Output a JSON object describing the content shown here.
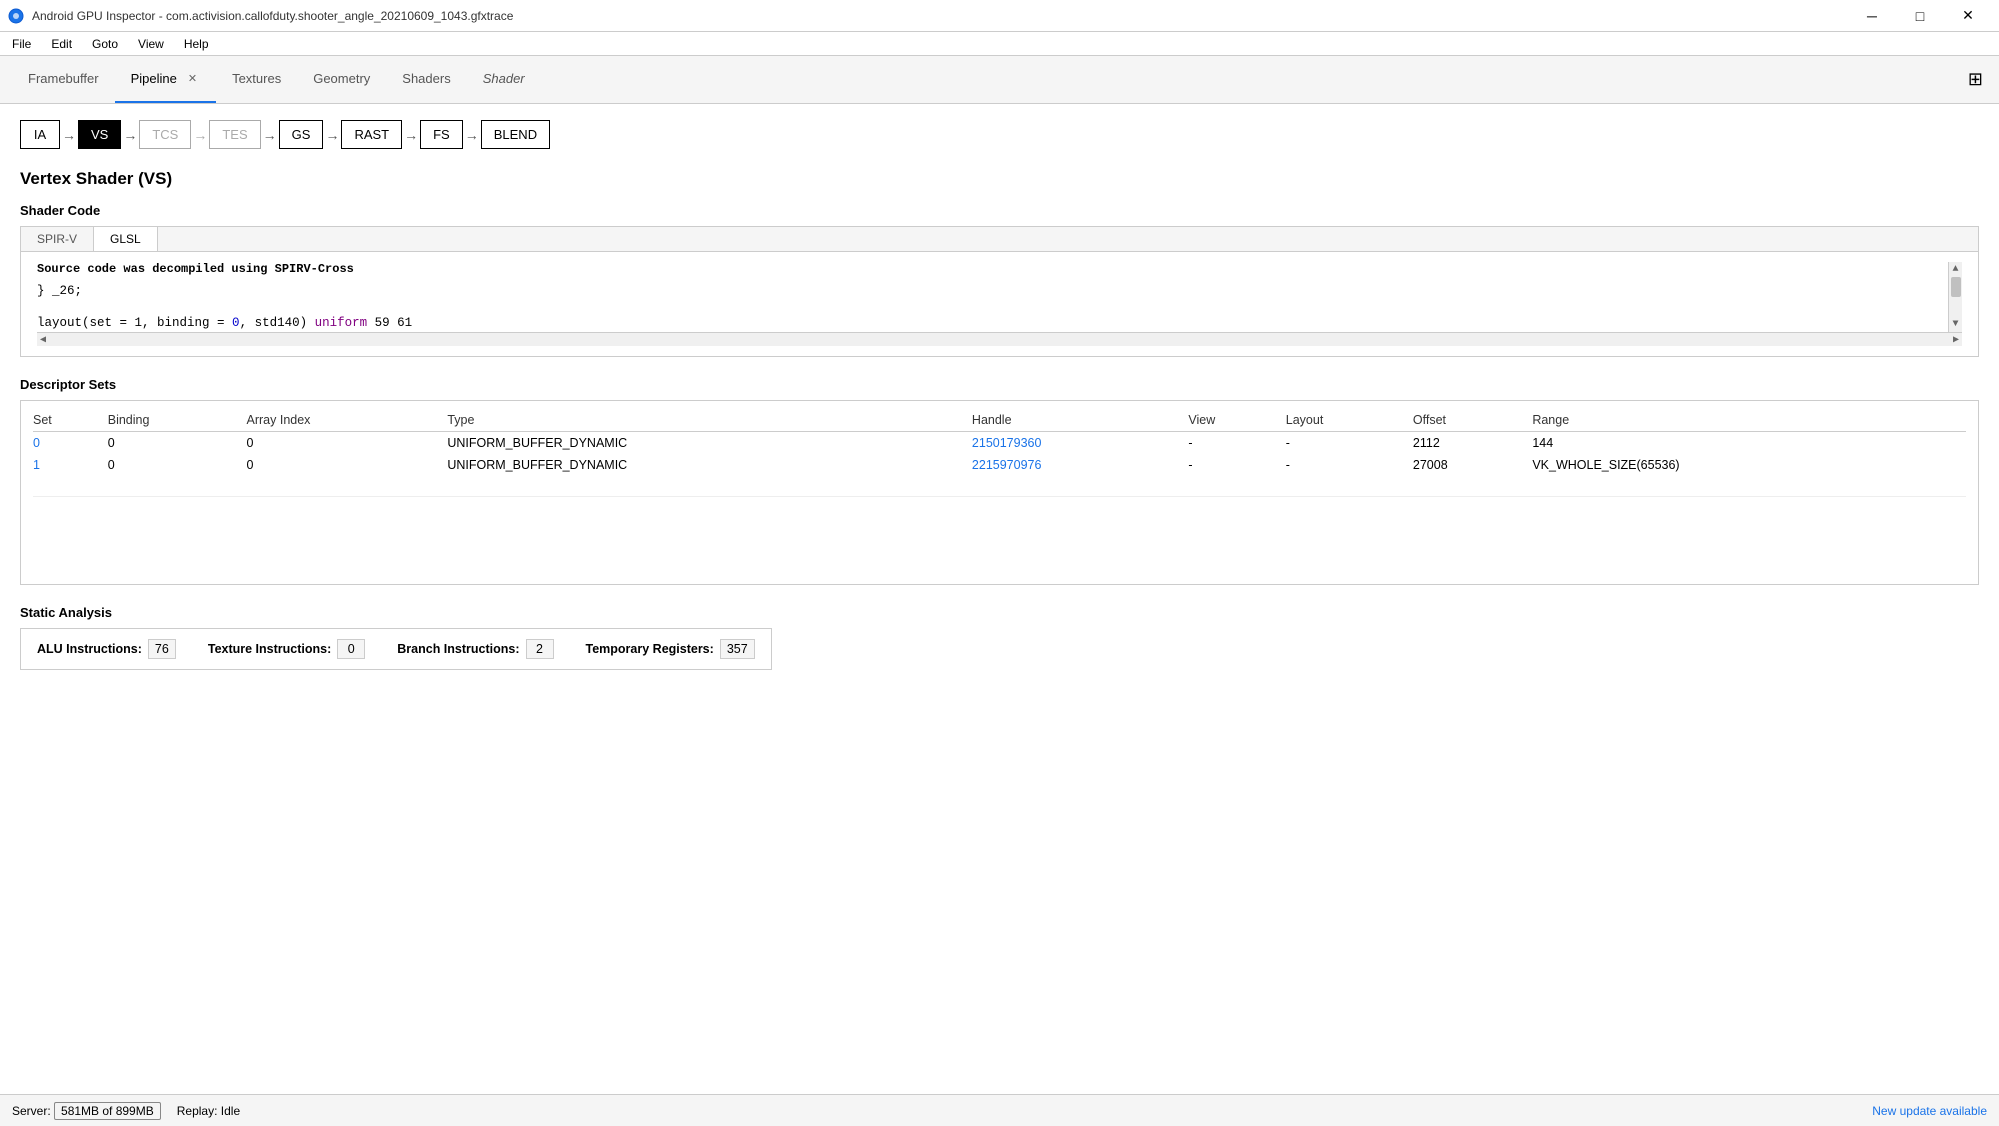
{
  "window": {
    "title": "Android GPU Inspector - com.activision.callofduty.shooter_angle_20210609_1043.gfxtrace",
    "minimize_label": "─",
    "restore_label": "□",
    "close_label": "✕"
  },
  "menu": {
    "items": [
      "File",
      "Edit",
      "Goto",
      "View",
      "Help"
    ]
  },
  "tabs": {
    "items": [
      {
        "label": "Framebuffer",
        "active": false,
        "closable": false
      },
      {
        "label": "Pipeline",
        "active": true,
        "closable": true
      },
      {
        "label": "Textures",
        "active": false,
        "closable": false
      },
      {
        "label": "Geometry",
        "active": false,
        "closable": false
      },
      {
        "label": "Shaders",
        "active": false,
        "closable": false
      },
      {
        "label": "Shader",
        "active": false,
        "closable": false,
        "italic": true
      }
    ]
  },
  "pipeline": {
    "stages": [
      {
        "label": "IA",
        "active": false,
        "dimmed": false
      },
      {
        "label": "VS",
        "active": true,
        "dimmed": false
      },
      {
        "label": "TCS",
        "active": false,
        "dimmed": true
      },
      {
        "label": "TES",
        "active": false,
        "dimmed": true
      },
      {
        "label": "GS",
        "active": false,
        "dimmed": false
      },
      {
        "label": "RAST",
        "active": false,
        "dimmed": false
      },
      {
        "label": "FS",
        "active": false,
        "dimmed": false
      },
      {
        "label": "BLEND",
        "active": false,
        "dimmed": false
      }
    ],
    "arrows": [
      "→",
      "→",
      "→",
      "→",
      "→",
      "→",
      "→"
    ]
  },
  "vertex_shader": {
    "title": "Vertex Shader (VS)",
    "shader_code": {
      "title": "Shader Code",
      "tabs": [
        "SPIR-V",
        "GLSL"
      ],
      "active_tab": "GLSL",
      "note": "Source code was decompiled using SPIRV-Cross",
      "lines": [
        {
          "text": "} _26;",
          "type": "plain"
        },
        {
          "text": "",
          "type": "plain"
        },
        {
          "text": "layout(set = 1, binding = 0, std140) uniform 59 61",
          "type": "code"
        }
      ]
    },
    "descriptor_sets": {
      "title": "Descriptor Sets",
      "columns": [
        "Set",
        "Binding",
        "Array Index",
        "Type",
        "Handle",
        "View",
        "Layout",
        "Offset",
        "Range"
      ],
      "rows": [
        {
          "set": "0",
          "set_link": true,
          "binding": "0",
          "array_index": "0",
          "type": "UNIFORM_BUFFER_DYNAMIC",
          "handle": "2150179360",
          "handle_link": true,
          "view": "-",
          "layout": "-",
          "offset": "2112",
          "range": "144"
        },
        {
          "set": "1",
          "set_link": true,
          "binding": "0",
          "array_index": "0",
          "type": "UNIFORM_BUFFER_DYNAMIC",
          "handle": "2215970976",
          "handle_link": true,
          "view": "-",
          "layout": "-",
          "offset": "27008",
          "range": "VK_WHOLE_SIZE(65536)"
        }
      ]
    },
    "static_analysis": {
      "title": "Static Analysis",
      "stats": [
        {
          "label": "ALU Instructions:",
          "value": "76"
        },
        {
          "label": "Texture Instructions:",
          "value": "0"
        },
        {
          "label": "Branch Instructions:",
          "value": "2"
        },
        {
          "label": "Temporary Registers:",
          "value": "357"
        }
      ]
    }
  },
  "status_bar": {
    "server_label": "Server:",
    "server_value": "581MB of 899MB",
    "replay_label": "Replay:",
    "replay_value": "Idle",
    "update_link": "New update available"
  }
}
